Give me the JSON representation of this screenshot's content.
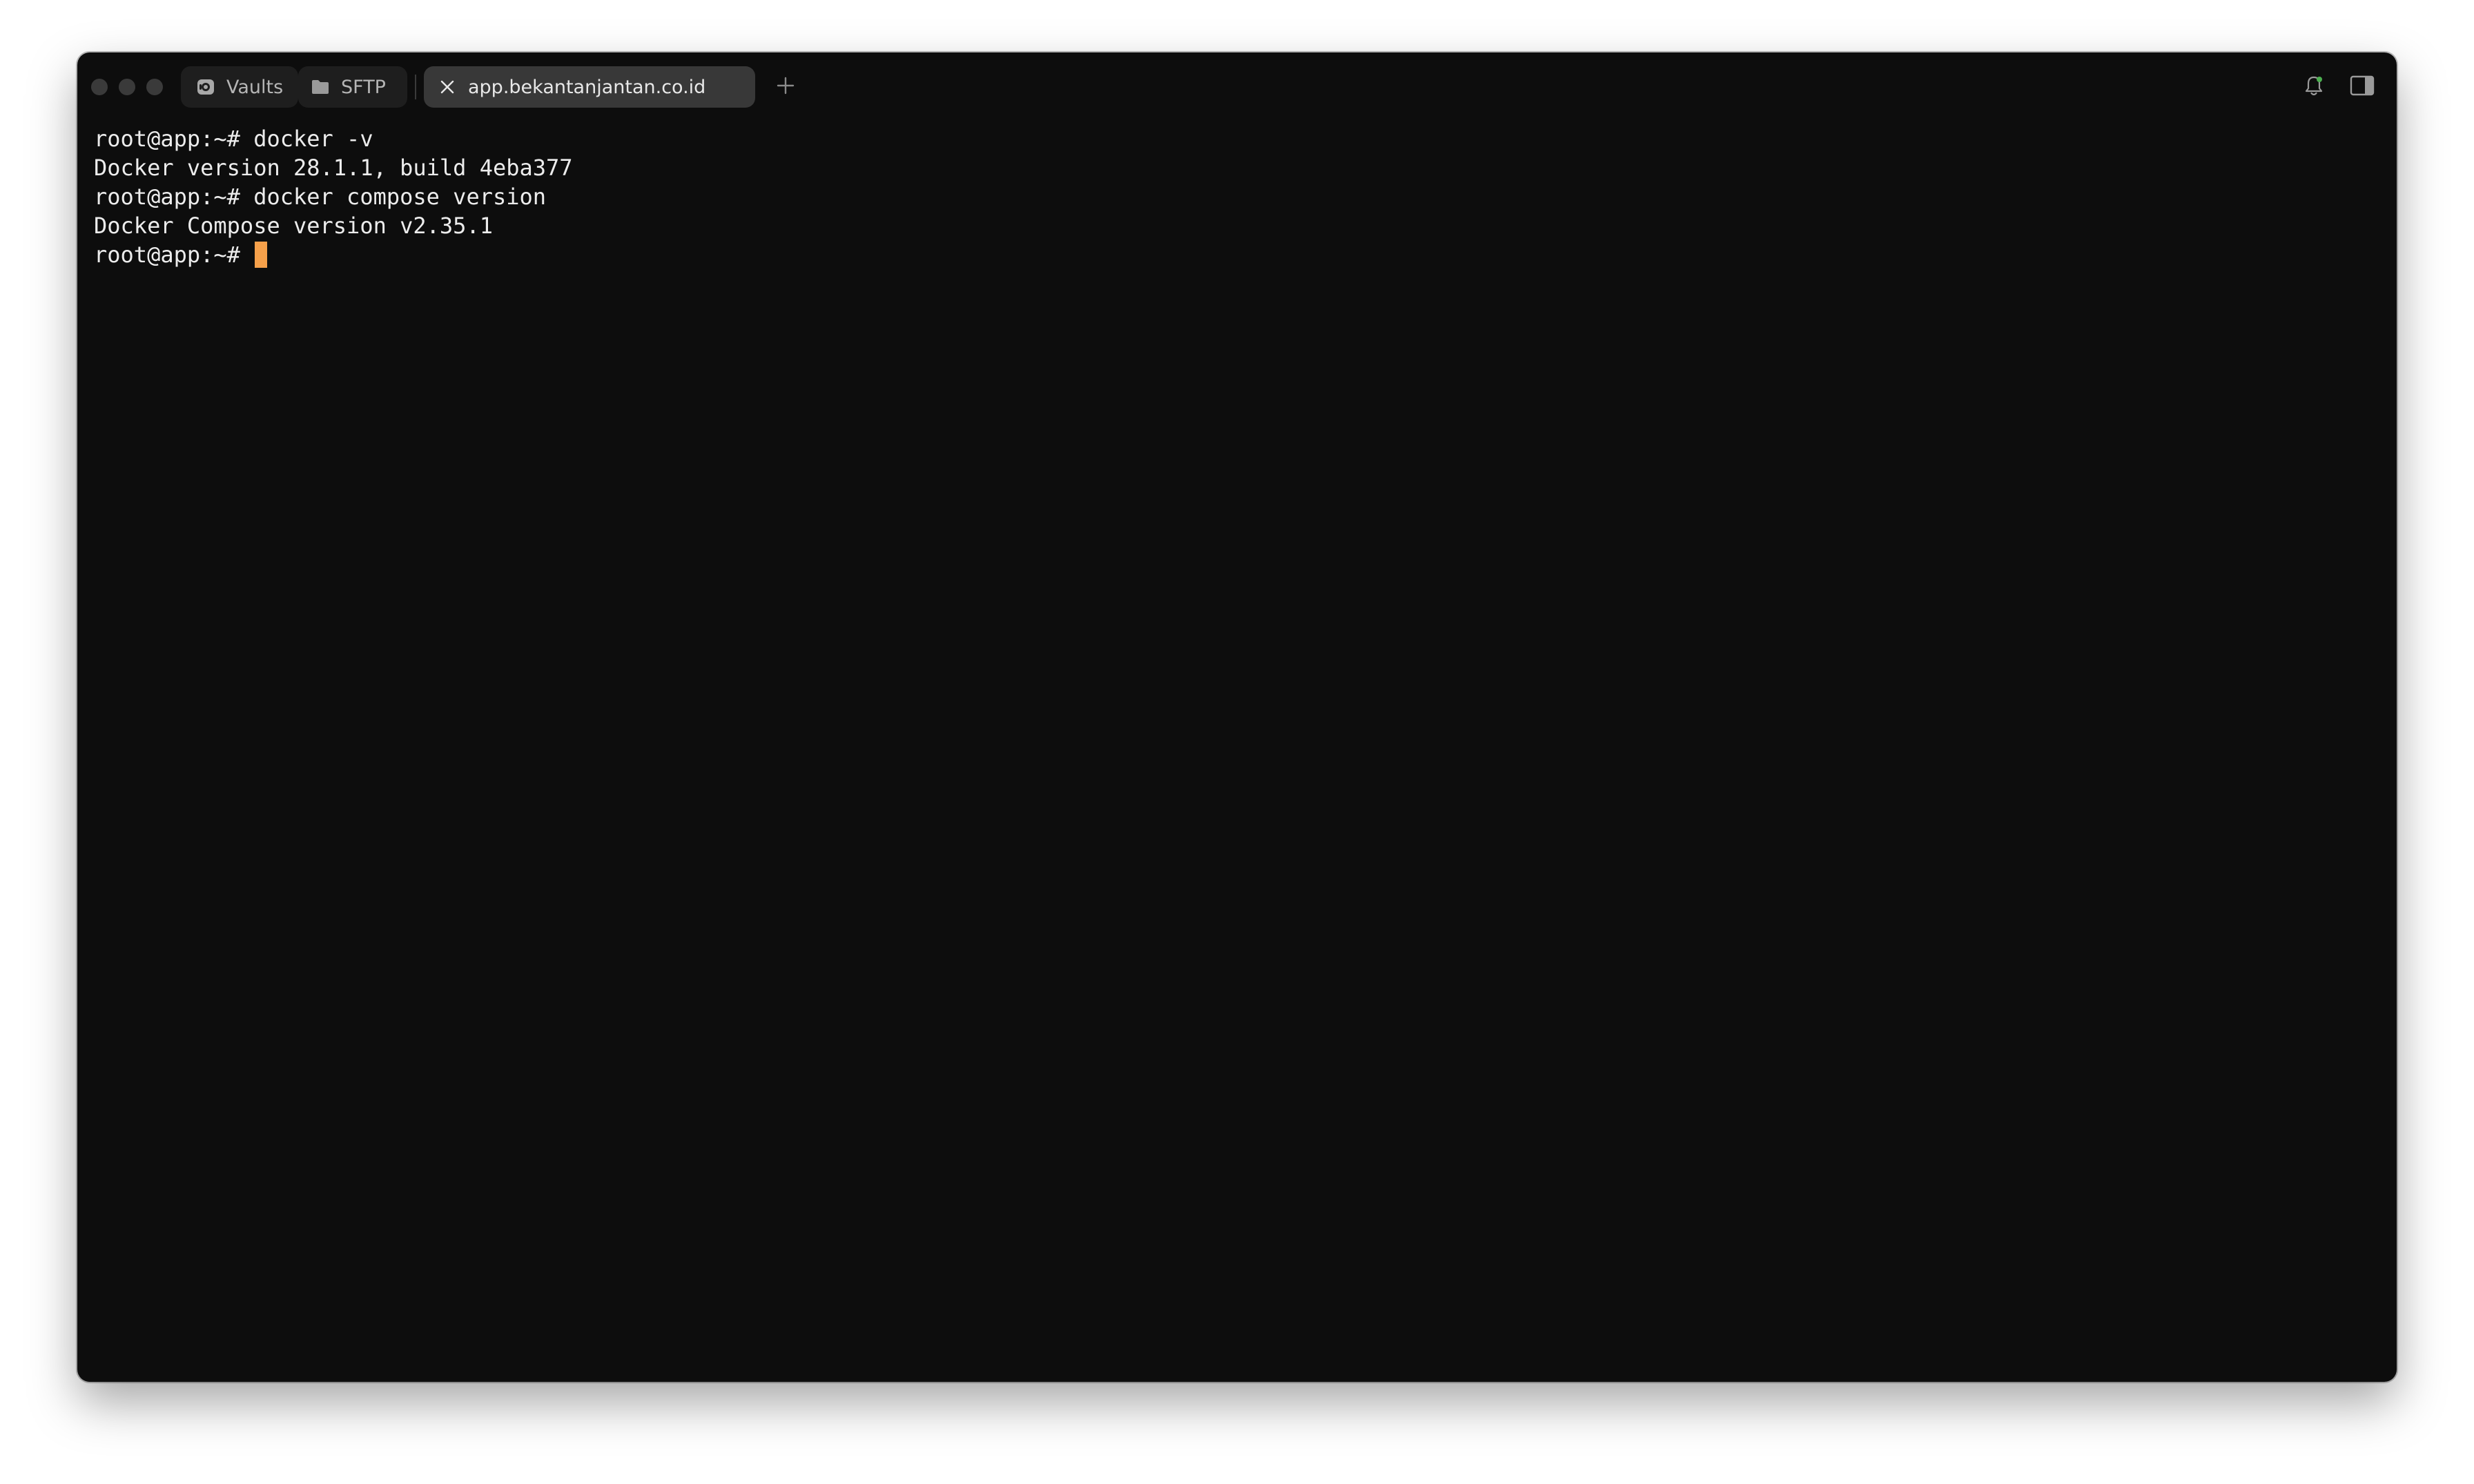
{
  "window": {
    "title_tabs": [
      {
        "label": "Vaults",
        "icon": "vault-icon"
      },
      {
        "label": "SFTP",
        "icon": "folder-icon"
      },
      {
        "label": "app.bekantanjantan.co.id",
        "icon": "close-icon",
        "active": true
      }
    ],
    "new_tab_icon": "plus-icon",
    "right_icons": [
      "bell-icon",
      "sidebar-toggle-icon"
    ]
  },
  "terminal": {
    "lines": [
      "root@app:~# docker -v",
      "Docker version 28.1.1, build 4eba377",
      "root@app:~# docker compose version",
      "Docker Compose version v2.35.1",
      "root@app:~# "
    ],
    "cursor_color": "#f5a04a"
  },
  "colors": {
    "background": "#0d0d0d",
    "text": "#ececec",
    "active_tab": "#383838",
    "inactive_tab": "#1e1e1e"
  }
}
